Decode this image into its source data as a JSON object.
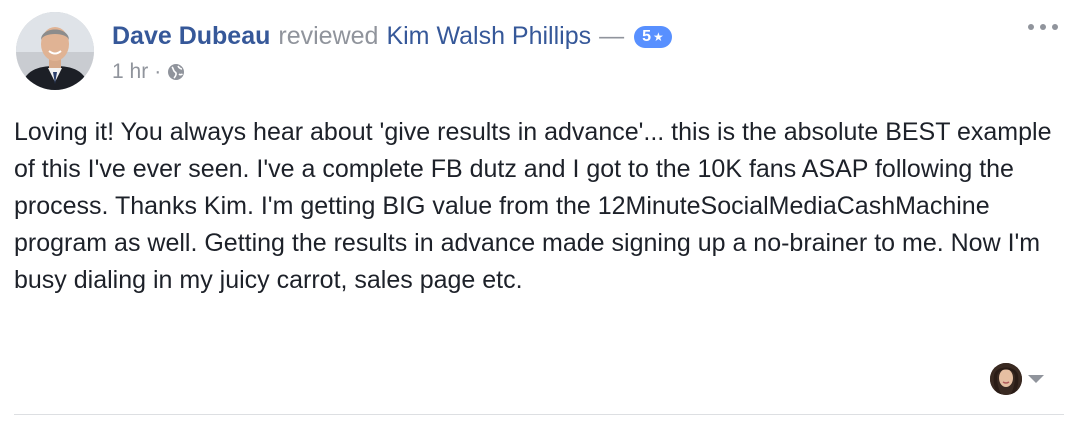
{
  "post": {
    "author": "Dave Dubeau",
    "action": "reviewed",
    "page_name": "Kim Walsh Phillips",
    "dash": "—",
    "rating": "5",
    "rating_star": "★",
    "timestamp": "1 hr",
    "meta_separator": "·",
    "privacy_icon": "globe-icon",
    "review_text": "Loving it! You always hear about 'give results in advance'... this is the absolute BEST example of this I've ever seen. I've a complete FB dutz and I got to the 10K fans ASAP following the process. Thanks Kim. I'm getting BIG value from the 12MinuteSocialMediaCashMachine program as well. Getting the results in advance made signing up a no-brainer to me. Now I'm busy dialing in my juicy carrot, sales page etc."
  },
  "colors": {
    "link": "#365899",
    "muted": "#90949c",
    "badge": "#5890ff",
    "text": "#1d2129",
    "divider": "#dddfe2"
  },
  "icons": {
    "more": "more-options-icon",
    "reply_caret": "chevron-down-icon"
  }
}
